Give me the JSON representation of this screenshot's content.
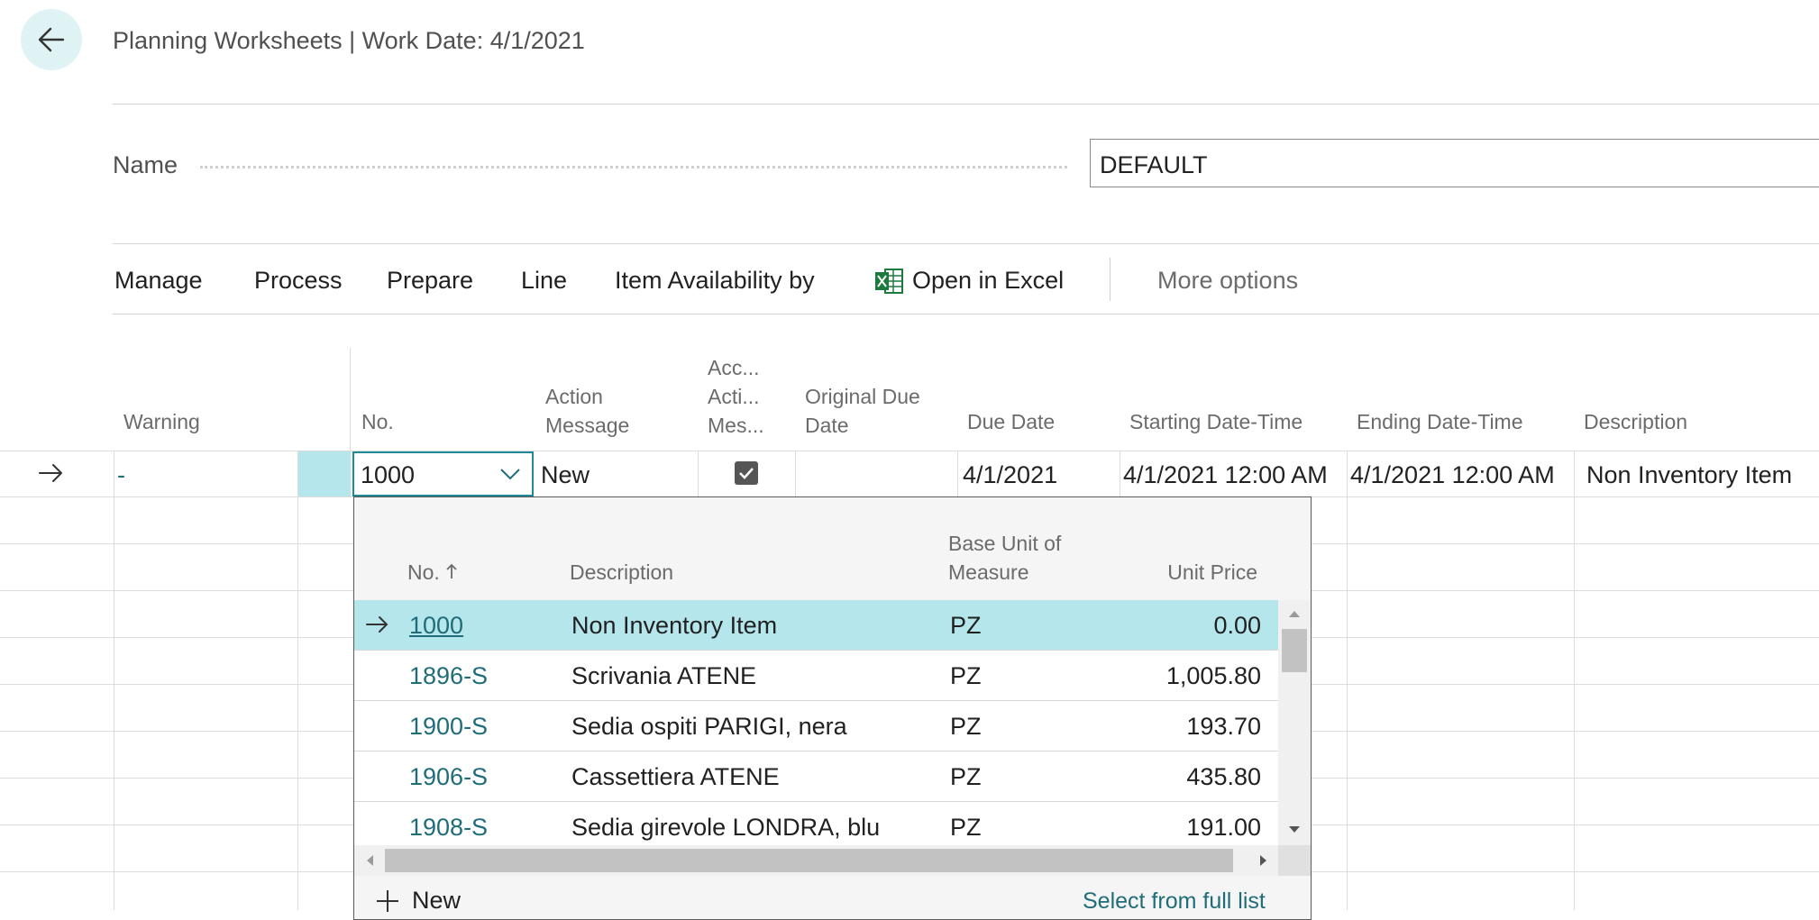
{
  "header": {
    "title": "Planning Worksheets | Work Date: 4/1/2021"
  },
  "name_field": {
    "label": "Name",
    "value": "DEFAULT"
  },
  "actions": {
    "manage": "Manage",
    "process": "Process",
    "prepare": "Prepare",
    "line": "Line",
    "item_availability": "Item Availability by",
    "open_in_excel": "Open in Excel",
    "more_options": "More options"
  },
  "grid": {
    "columns": {
      "warning": "Warning",
      "no": "No.",
      "action_message_1": "Action",
      "action_message_2": "Message",
      "accept_1": "Acc...",
      "accept_2": "Acti...",
      "accept_3": "Mes...",
      "original_due_1": "Original Due",
      "original_due_2": "Date",
      "due_date": "Due Date",
      "starting_dt": "Starting Date-Time",
      "ending_dt": "Ending Date-Time",
      "description": "Description"
    },
    "current_row": {
      "warning": "-",
      "no": "1000",
      "action_message": "New",
      "accept": true,
      "original_due": "",
      "due_date": "4/1/2021",
      "starting_dt": "4/1/2021 12:00 AM",
      "ending_dt": "4/1/2021 12:00 AM",
      "description": "Non Inventory Item"
    }
  },
  "lookup": {
    "headers": {
      "no": "No.",
      "description": "Description",
      "base_unit_1": "Base Unit of",
      "base_unit_2": "Measure",
      "unit_price": "Unit Price"
    },
    "rows": [
      {
        "no": "1000",
        "description": "Non Inventory Item",
        "unit": "PZ",
        "price": "0.00"
      },
      {
        "no": "1896-S",
        "description": "Scrivania ATENE",
        "unit": "PZ",
        "price": "1,005.80"
      },
      {
        "no": "1900-S",
        "description": "Sedia ospiti PARIGI, nera",
        "unit": "PZ",
        "price": "193.70"
      },
      {
        "no": "1906-S",
        "description": "Cassettiera ATENE",
        "unit": "PZ",
        "price": "435.80"
      },
      {
        "no": "1908-S",
        "description": "Sedia girevole LONDRA, blu",
        "unit": "PZ",
        "price": "191.00"
      }
    ],
    "new_label": "New",
    "select_full_list": "Select from full list"
  },
  "colors": {
    "accent": "#1f6d78",
    "selection": "#b4e6ec",
    "back_button": "#dff2f4",
    "excel_green": "#1d7a3e"
  }
}
